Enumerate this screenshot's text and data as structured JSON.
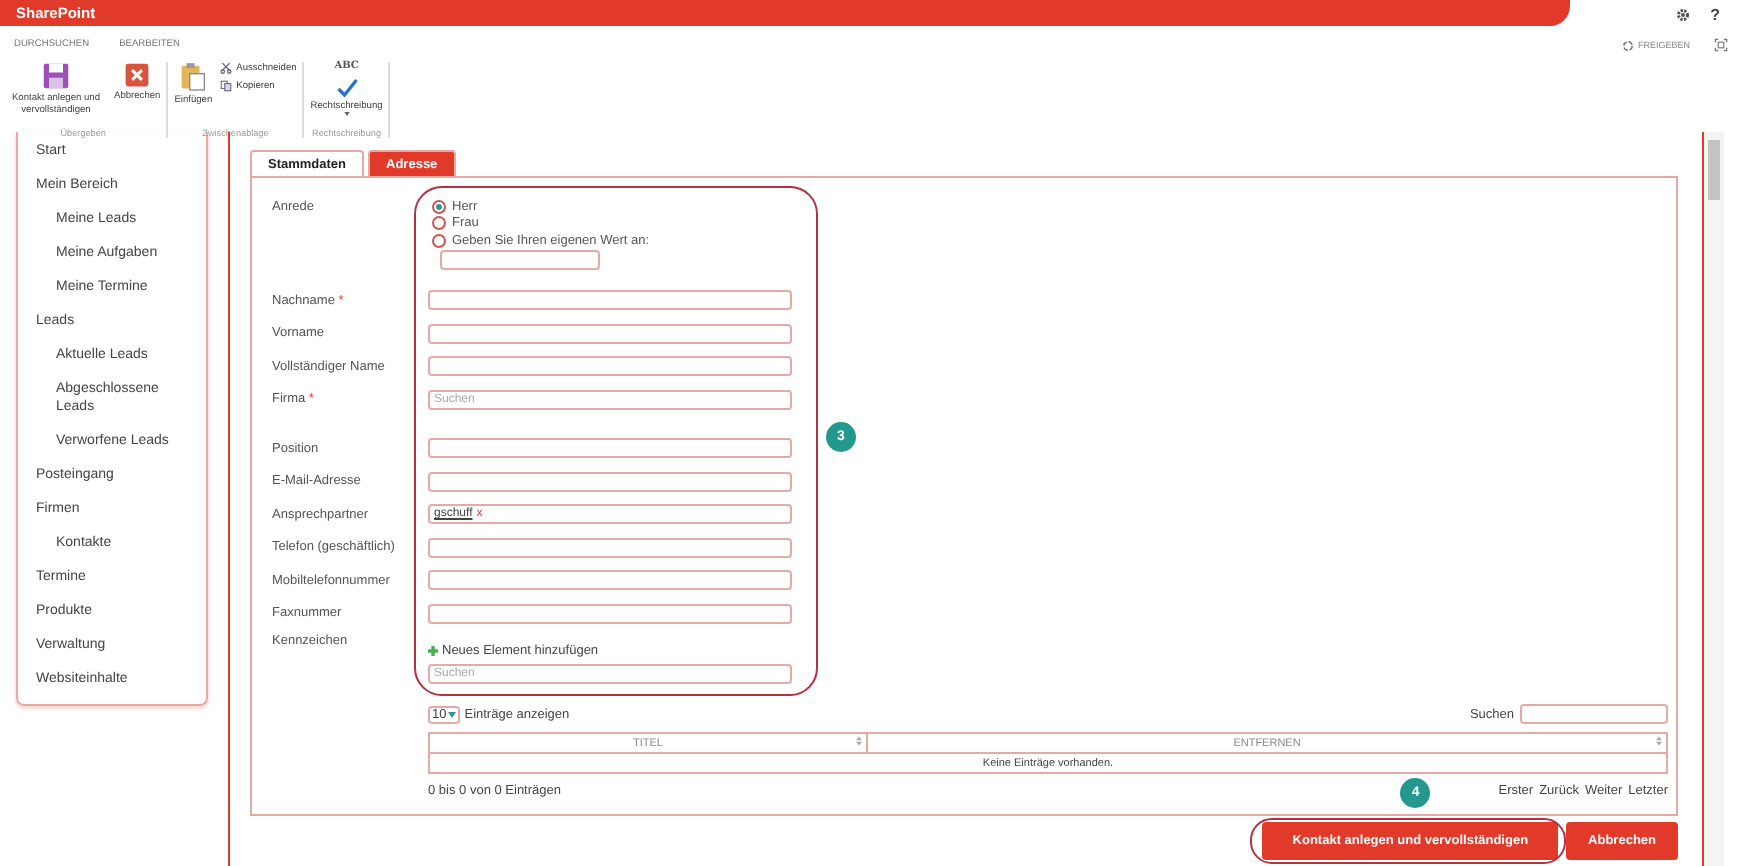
{
  "app": {
    "title": "SharePoint",
    "help": "?",
    "share": "FREIGEBEN"
  },
  "ribbon": {
    "tabs": [
      "DURCHSUCHEN",
      "BEARBEITEN"
    ],
    "groups": [
      {
        "label": "Übergeben",
        "commands": [
          {
            "kind": "save",
            "label": "Kontakt anlegen und vervollständigen"
          },
          {
            "kind": "cancel",
            "label": "Abbrechen"
          }
        ]
      },
      {
        "label": "Zwischenablage",
        "commands": [
          {
            "kind": "paste",
            "label": "Einfügen"
          },
          {
            "kind": "cut",
            "label": "Ausschneiden"
          },
          {
            "kind": "copy",
            "label": "Kopieren"
          }
        ]
      },
      {
        "label": "Rechtschreibung",
        "commands": [
          {
            "kind": "spelling",
            "label": "Rechtschreibung",
            "icon_text": "ABC"
          }
        ]
      }
    ]
  },
  "sidebar": {
    "items": [
      {
        "label": "Start"
      },
      {
        "label": "Mein Bereich",
        "children": [
          {
            "label": "Meine Leads"
          },
          {
            "label": "Meine Aufgaben"
          },
          {
            "label": "Meine Termine"
          }
        ]
      },
      {
        "label": "Leads",
        "children": [
          {
            "label": "Aktuelle Leads"
          },
          {
            "label": "Abgeschlossene Leads"
          },
          {
            "label": "Verworfene Leads"
          }
        ]
      },
      {
        "label": "Posteingang"
      },
      {
        "label": "Firmen",
        "children": [
          {
            "label": "Kontakte"
          }
        ]
      },
      {
        "label": "Termine"
      },
      {
        "label": "Produkte"
      },
      {
        "label": "Verwaltung"
      },
      {
        "label": "Websiteinhalte"
      }
    ]
  },
  "form": {
    "tabs": [
      {
        "label": "Stammdaten",
        "selected": true
      },
      {
        "label": "Adresse",
        "selected": false
      }
    ],
    "fields": [
      {
        "kind": "choice",
        "label": "Anrede",
        "options": [
          {
            "label": "Herr",
            "selected": true
          },
          {
            "label": "Frau",
            "selected": false
          },
          {
            "label": "Geben Sie Ihren eigenen Wert an:",
            "selected": false
          }
        ]
      },
      {
        "kind": "text",
        "label": "Nachname",
        "required_mark": "*"
      },
      {
        "kind": "text",
        "label": "Vorname"
      },
      {
        "kind": "text",
        "label": "Vollständiger Name"
      },
      {
        "kind": "lookup",
        "label": "Firma",
        "required_mark": "*",
        "placeholder": "Suchen"
      },
      {
        "kind": "text",
        "label": "Position"
      },
      {
        "kind": "text",
        "label": "E-Mail-Adresse"
      },
      {
        "kind": "people",
        "label": "Ansprechpartner",
        "value": "gschuff",
        "remove": "x"
      },
      {
        "kind": "text",
        "label": "Telefon (geschäftlich)"
      },
      {
        "kind": "text",
        "label": "Mobiltelefonnummer"
      },
      {
        "kind": "text",
        "label": "Faxnummer"
      },
      {
        "kind": "tags",
        "label": "Kennzeichen",
        "add_label": "Neues Element hinzufügen",
        "placeholder": "Suchen"
      }
    ],
    "table": {
      "page_size": "10",
      "length_label": "Einträge anzeigen",
      "search_label": "Suchen",
      "columns": [
        "TITEL",
        "ENTFERNEN"
      ],
      "empty": "Keine Einträge vorhanden.",
      "info": "0 bis 0 von 0 Einträgen",
      "pager": [
        "Erster",
        "Zurück",
        "Weiter",
        "Letzter"
      ]
    }
  },
  "actions": [
    {
      "kind": "primary",
      "label": "Kontakt anlegen und vervollständigen"
    },
    {
      "kind": "secondary",
      "label": "Abbrechen"
    }
  ],
  "annotations": [
    {
      "label": "3"
    },
    {
      "label": "4"
    }
  ]
}
